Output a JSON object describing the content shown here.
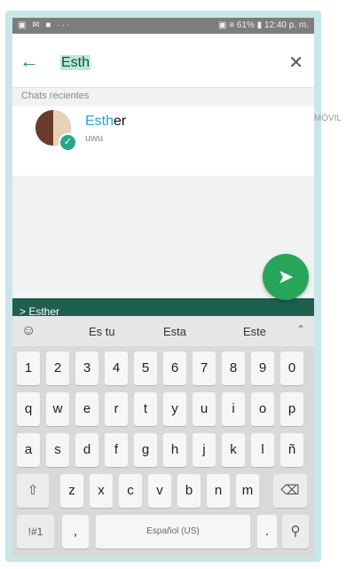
{
  "status_bar": {
    "left": "▣ ✉ ■ ···",
    "right": "▣ ≡ 61% ▮ 12:40 p. m."
  },
  "search": {
    "query_highlight": "Esth",
    "back_icon": "back-arrow-icon",
    "close_icon": "close-icon"
  },
  "section_header": "Chats recientes",
  "chat": {
    "name_match": "Esth",
    "name_rest": "er",
    "status": "uwu",
    "type": "MÓVIL"
  },
  "selected_chip": "> Esther",
  "suggestions": [
    "Es tu",
    "Esta",
    "Este"
  ],
  "keyboard": {
    "row1": [
      "1",
      "2",
      "3",
      "4",
      "5",
      "6",
      "7",
      "8",
      "9",
      "0"
    ],
    "row2": [
      "q",
      "w",
      "e",
      "r",
      "t",
      "y",
      "u",
      "i",
      "o",
      "p"
    ],
    "row3": [
      "a",
      "s",
      "d",
      "f",
      "g",
      "h",
      "j",
      "k",
      "l",
      "ñ"
    ],
    "row4": [
      "z",
      "x",
      "c",
      "v",
      "b",
      "n",
      "m"
    ],
    "symbols": "!#1",
    "comma": ",",
    "space_label": "Español (US)",
    "period": "."
  },
  "colors": {
    "brand": "#1f5f4e",
    "fab": "#27a65b",
    "highlight": "#b7ead7",
    "frame": "#c9e6e8"
  }
}
